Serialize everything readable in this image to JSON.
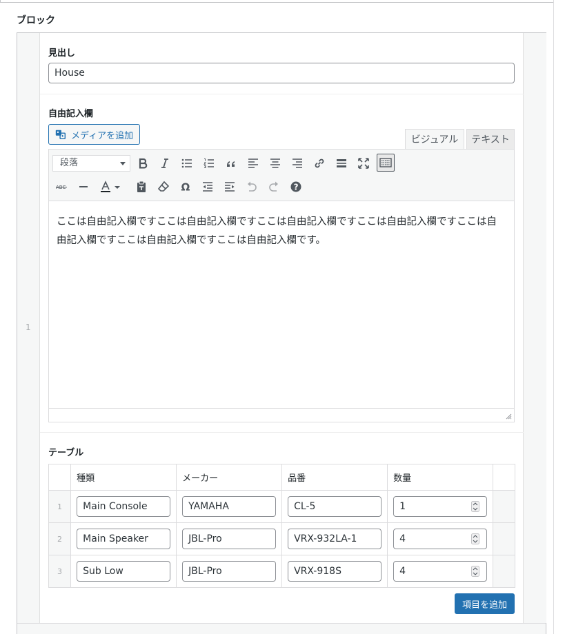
{
  "block": {
    "label": "ブロック",
    "row_number": "1"
  },
  "heading": {
    "label": "見出し",
    "value": "House"
  },
  "freeform": {
    "label": "自由記入欄",
    "media_button": "メディアを追加",
    "tab_visual": "ビジュアル",
    "tab_text": "テキスト",
    "format_select": "段落",
    "content": "ここは自由記入欄ですここは自由記入欄ですここは自由記入欄ですここは自由記入欄ですここは自由記入欄ですここは自由記入欄ですここは自由記入欄です。"
  },
  "table": {
    "label": "テーブル",
    "columns": [
      "種類",
      "メーカー",
      "品番",
      "数量"
    ],
    "rows": [
      {
        "num": "1",
        "type": "Main Console",
        "maker": "YAMAHA",
        "model": "CL-5",
        "qty": "1"
      },
      {
        "num": "2",
        "type": "Main Speaker",
        "maker": "JBL-Pro",
        "model": "VRX-932LA-1",
        "qty": "4"
      },
      {
        "num": "3",
        "type": "Sub Low",
        "maker": "JBL-Pro",
        "model": "VRX-918S",
        "qty": "4"
      }
    ],
    "add_button": "項目を追加"
  },
  "colors": {
    "accent": "#2271b1",
    "border": "#c3c4c7",
    "toolbar_bg": "#f6f7f7"
  },
  "toolbar_icons": [
    "bold-icon",
    "italic-icon",
    "bulleted-list-icon",
    "numbered-list-icon",
    "blockquote-icon",
    "align-left-icon",
    "align-center-icon",
    "align-right-icon",
    "link-icon",
    "read-more-icon",
    "fullscreen-icon",
    "toolbar-toggle-icon",
    "strikethrough-icon",
    "horizontal-line-icon",
    "text-color-icon",
    "paste-as-text-icon",
    "clear-formatting-icon",
    "special-character-icon",
    "outdent-icon",
    "indent-icon",
    "undo-icon",
    "redo-icon",
    "help-icon"
  ]
}
